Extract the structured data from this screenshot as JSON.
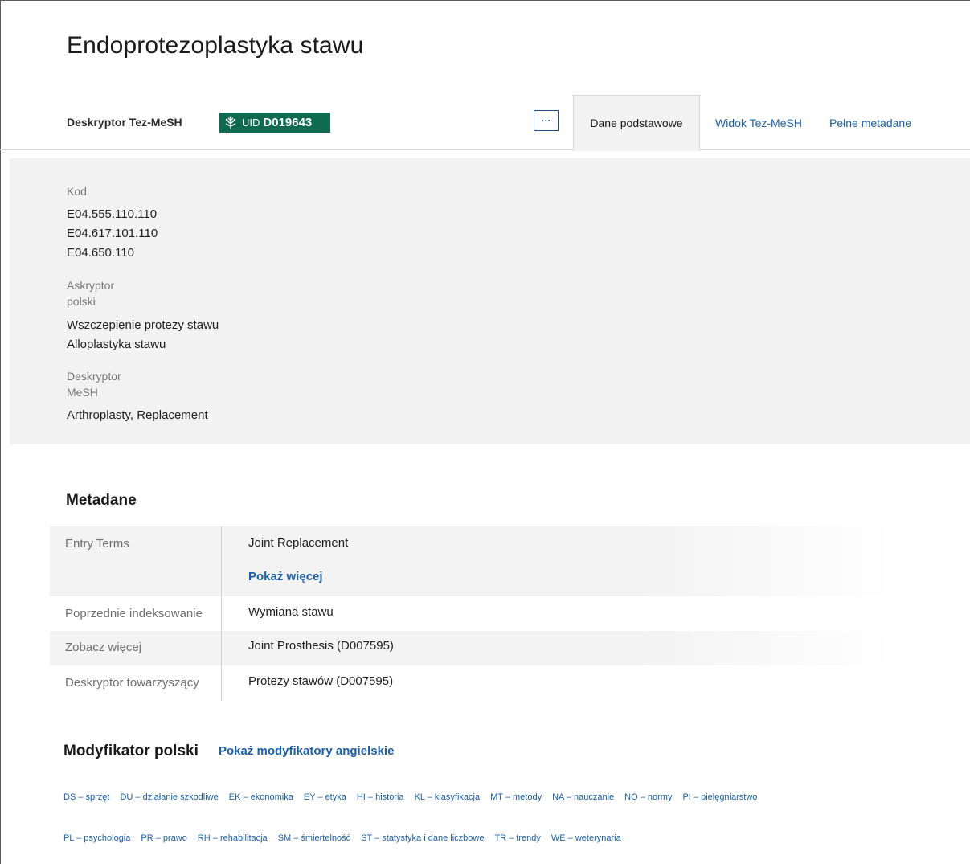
{
  "page": {
    "title": "Endoprotezoplastyka stawu"
  },
  "header": {
    "descriptor_label": "Deskryptor Tez-MeSH",
    "uid_prefix": "UID",
    "uid_value": "D019643",
    "more_button": "···",
    "tabs": [
      {
        "label": "Dane podstawowe",
        "active": true
      },
      {
        "label": "Widok Tez-MeSH",
        "active": false
      },
      {
        "label": "Pełne metadane",
        "active": false
      }
    ]
  },
  "basic": {
    "kod_label": "Kod",
    "codes": [
      "E04.555.110.110",
      "E04.617.101.110",
      "E04.650.110"
    ],
    "askryptor_label": "Askryptor",
    "askryptor_sub": "polski",
    "askryptors": [
      "Wszczepienie protezy stawu",
      "Alloplastyka stawu"
    ],
    "deskryptor_label": "Deskryptor",
    "deskryptor_sub": "MeSH",
    "deskryptor_value": "Arthroplasty, Replacement"
  },
  "metadane": {
    "heading": "Metadane",
    "rows": [
      {
        "key": "Entry Terms",
        "value": "Joint Replacement",
        "link": "Pokaż więcej"
      },
      {
        "key": "Poprzednie indeksowanie",
        "value": "Wymiana stawu"
      },
      {
        "key": "Zobacz więcej",
        "value": "Joint Prosthesis (D007595)"
      },
      {
        "key": "Deskryptor towarzyszący",
        "value": "Protezy stawów (D007595)"
      }
    ]
  },
  "modifiers": {
    "heading": "Modyfikator polski",
    "toggle": "Pokaż modyfikatory angielskie",
    "row1": [
      "DS – sprzęt",
      "DU – działanie szkodliwe",
      "EK – ekonomika",
      "EY – etyka",
      "HI – historia",
      "KL – klasyfikacja",
      "MT – metody",
      "NA – nauczanie",
      "NO – normy",
      "PI – pielęgniarstwo"
    ],
    "row2": [
      "PL – psychologia",
      "PR – prawo",
      "RH – rehabilitacja",
      "SM – śmiertelność",
      "ST – statystyka i dane liczbowe",
      "TR – trendy",
      "WE – weterynaria"
    ]
  },
  "colors": {
    "badge": "#0f6b4f",
    "link": "#1b5fa8",
    "panel": "#f2f2f2"
  },
  "icons": {
    "badge_logo": "mesh-tree-logo-icon",
    "more": "ellipsis-icon"
  }
}
